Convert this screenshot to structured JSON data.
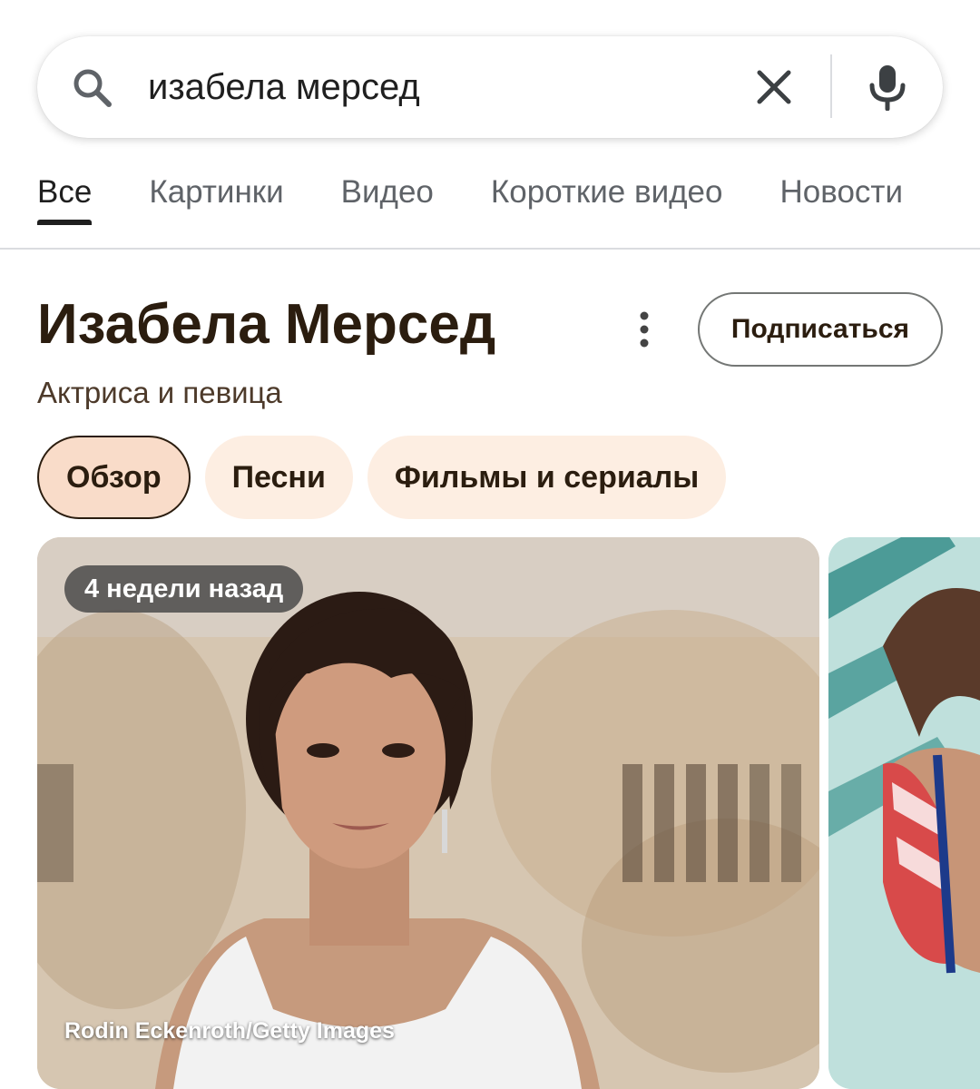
{
  "search": {
    "query": "изабела мерсед",
    "icons": {
      "search": "search-icon",
      "clear": "close-icon",
      "voice": "mic-icon"
    }
  },
  "tabs": [
    {
      "label": "Все",
      "active": true
    },
    {
      "label": "Картинки"
    },
    {
      "label": "Видео"
    },
    {
      "label": "Короткие видео"
    },
    {
      "label": "Новости"
    }
  ],
  "knowledge_panel": {
    "title": "Изабела Мерсед",
    "subtitle": "Актриса и певица",
    "subscribe_label": "Подписаться",
    "more_icon": "more-vert-icon",
    "chips": [
      {
        "label": "Обзор",
        "active": true
      },
      {
        "label": "Песни"
      },
      {
        "label": "Фильмы и сериалы"
      }
    ]
  },
  "photos": {
    "main": {
      "badge": "4 недели назад",
      "credit": "Rodin Eckenroth/Getty Images"
    }
  },
  "colors": {
    "accent_dark": "#2b1d0f",
    "chip_bg": "#fdeee2",
    "chip_active_bg": "#f9dcc9",
    "tab_inactive": "#5f6368"
  }
}
